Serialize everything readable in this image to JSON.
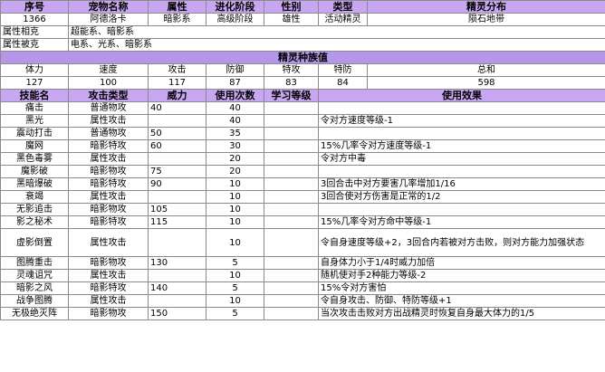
{
  "header": {
    "cols": [
      "序号",
      "宠物名称",
      "属性",
      "进化阶段",
      "性别",
      "类型",
      "精灵分布"
    ],
    "values": [
      "1366",
      "阿德洛卡",
      "暗影系",
      "高级阶段",
      "雄性",
      "活动精灵",
      "陨石地带"
    ]
  },
  "restraint": [
    {
      "label": "属性相克",
      "value": "超能系、暗影系"
    },
    {
      "label": "属性被克",
      "value": "电系、光系、暗影系"
    }
  ],
  "stats": {
    "title": "精灵种族值",
    "cols": [
      "体力",
      "速度",
      "攻击",
      "防御",
      "特攻",
      "特防",
      "总和"
    ],
    "values": [
      "127",
      "100",
      "117",
      "87",
      "83",
      "84",
      "598"
    ]
  },
  "skills": {
    "cols": [
      "技能名",
      "攻击类型",
      "威力",
      "使用次数",
      "学习等级",
      "使用效果"
    ],
    "rows": [
      [
        "痛击",
        "普通物攻",
        "40",
        "40",
        "",
        ""
      ],
      [
        "黑光",
        "属性攻击",
        "",
        "40",
        "",
        "令对方速度等级-1"
      ],
      [
        "震动打击",
        "普通物攻",
        "50",
        "35",
        "",
        ""
      ],
      [
        "魔网",
        "暗影特攻",
        "60",
        "30",
        "",
        "15%几率令对方速度等级-1"
      ],
      [
        "黑色毒雾",
        "属性攻击",
        "",
        "20",
        "",
        "令对方中毒"
      ],
      [
        "魔影破",
        "暗影物攻",
        "75",
        "20",
        "",
        ""
      ],
      [
        "黑暗爆破",
        "暗影特攻",
        "90",
        "10",
        "",
        "3回合击中对方要害几率增加1/16"
      ],
      [
        "衰竭",
        "属性攻击",
        "",
        "10",
        "",
        "3回合使对方伤害是正常的1/2"
      ],
      [
        "无影追击",
        "暗影物攻",
        "105",
        "10",
        "",
        ""
      ],
      [
        "影之秘术",
        "暗影特攻",
        "115",
        "10",
        "",
        "15%几率令对方命中等级-1"
      ],
      [
        "虚影倒置",
        "属性攻击",
        "",
        "10",
        "",
        "令自身速度等级+2，3回合内若被对方击败，则对方能力加强状态"
      ],
      [
        "图腾重击",
        "暗影物攻",
        "130",
        "5",
        "",
        "自身体力小于1/4时威力加倍"
      ],
      [
        "灵魂诅咒",
        "属性攻击",
        "",
        "10",
        "",
        "随机使对手2种能力等级-2"
      ],
      [
        "暗影之风",
        "暗影特攻",
        "140",
        "5",
        "",
        "15%令对方害怕"
      ],
      [
        "战争图腾",
        "属性攻击",
        "",
        "10",
        "",
        "令自身攻击、防御、特防等级+1"
      ],
      [
        "无极绝灭阵",
        "暗影物攻",
        "150",
        "5",
        "",
        "当次攻击击败对方出战精灵时恢复自身最大体力的1/5"
      ]
    ]
  }
}
